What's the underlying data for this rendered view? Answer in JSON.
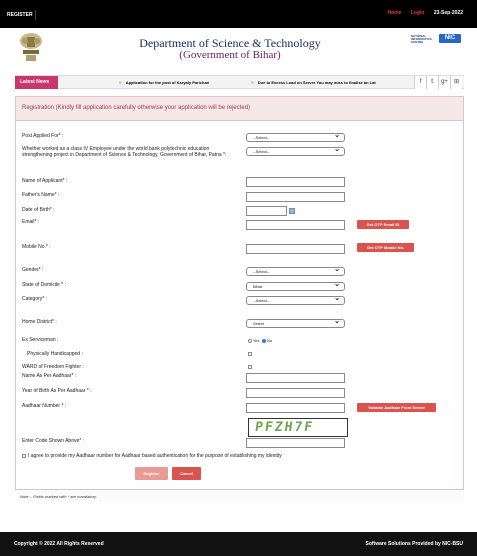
{
  "topbar": {
    "register_label": "REGISTER",
    "home_label": "Home",
    "login_label": "Login",
    "date": "23-Sep-2022"
  },
  "header": {
    "title": "Department of Science & Technology",
    "subtitle": "(Government of Bihar)",
    "nic_text": "NATIONAL INFORMATICS CENTRE",
    "nic_logo": "NIC"
  },
  "news": {
    "label": "Latest News",
    "items": [
      "Application for the post of Karyaly Parichari",
      "Due to Excess Load on Server You may miss to finalise an Lat"
    ],
    "social_icons": [
      "facebook-icon",
      "twitter-icon",
      "google-plus-icon",
      "share-icon"
    ]
  },
  "form": {
    "heading": "Registration (Kindly fill application carefully otherwise your application will be rejected)",
    "fields": {
      "post_applied_for": {
        "label": "Post Applied For* :",
        "value": "--Select--"
      },
      "class_iv": {
        "label": "Whether worked as a class IV Employee under the world bank polytechnic education strengthening project in Department of Science & Technology, Government of Bihar, Patna *:",
        "value": "--Select--"
      },
      "applicant_name": {
        "label": "Name of Applicant* :"
      },
      "father_name": {
        "label": "Father's Name* :"
      },
      "dob": {
        "label": "Date of Birth* :"
      },
      "email": {
        "label": "Email* :",
        "button": "Get OTP Email ID"
      },
      "mobile": {
        "label": "Mobile No.* :",
        "button": "Get OTP Mobile No."
      },
      "gender": {
        "label": "Gender* :",
        "value": "--Select--"
      },
      "domicile": {
        "label": "State of Domicile * :",
        "value": "Bihar"
      },
      "category": {
        "label": "Category* :",
        "value": "--Select--"
      },
      "home_district": {
        "label": "Home District* :",
        "value": "Select"
      },
      "ex_serviceman": {
        "label": "Ex Serviceman :",
        "yes": "Yes",
        "no": "No"
      },
      "physically_handicapped": {
        "label": "Physically Handicapped :"
      },
      "freedom_fighter": {
        "label": "WARD of Freedom Fighter :"
      },
      "name_aadhaar": {
        "label": "Name As Per Aadhaar* :"
      },
      "yob_aadhaar": {
        "label": "Year of Birth As Per Aadhaar * :"
      },
      "aadhaar_number": {
        "label": "Aadhaar Number * :",
        "button": "Validate Aadhaar From Server"
      },
      "captcha": {
        "label": "Enter Code Shown Above* :",
        "code": "PFZH7F"
      }
    },
    "consent": "I agree to provide my Aadhaar number for Aadhaar based authentication for the purpose of establishing my identity",
    "register_button": "Register",
    "cancel_button": "Cancel",
    "note": "Note :- Fields marked with * are mandatory."
  },
  "footer": {
    "copyright": "Copyright © 2022 All Rights Reserved",
    "provider": "Software Solutions Provided by NIC-BSU"
  },
  "colors": {
    "brand_red": "#d9534f",
    "news_label": "#c9366d",
    "title_blue": "#1e2a6b",
    "subtitle_purple": "#6b1e5f"
  }
}
